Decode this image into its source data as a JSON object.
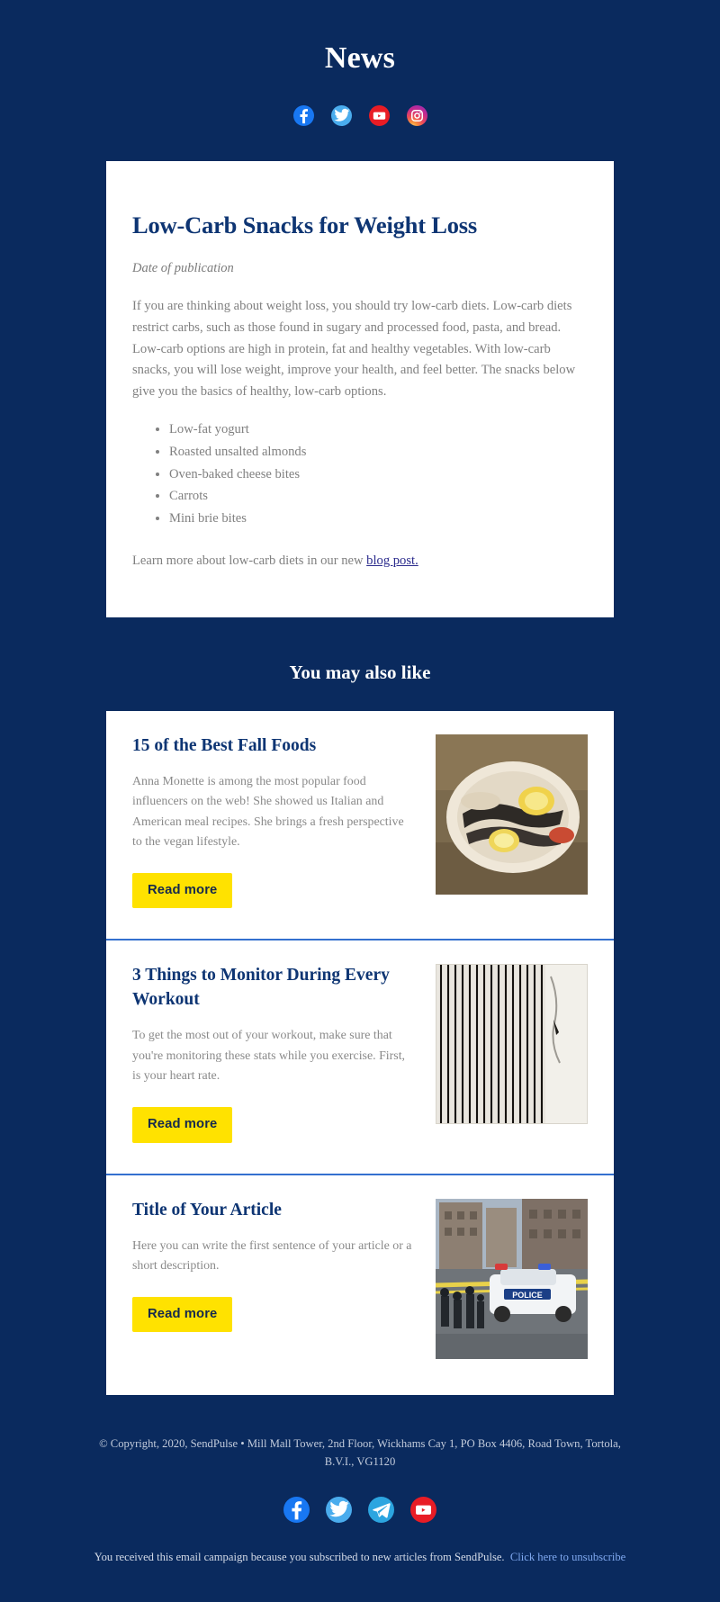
{
  "theme": {
    "background": "#0a2a5e",
    "card_background": "#ffffff",
    "heading_color": "#0e3573",
    "body_text_color": "#808080",
    "button_background": "#ffe200",
    "button_text_color": "#15294d",
    "divider_color": "#3470cf",
    "link_color": "#2a2a8c"
  },
  "header": {
    "title": "News",
    "social": [
      {
        "name": "facebook",
        "icon": "facebook-icon",
        "color": "#1877f2"
      },
      {
        "name": "twitter",
        "icon": "twitter-icon",
        "color": "#4aaced"
      },
      {
        "name": "youtube",
        "icon": "youtube-icon",
        "color": "#e81c25"
      },
      {
        "name": "instagram",
        "icon": "instagram-icon",
        "color": "#c3298f"
      }
    ]
  },
  "article": {
    "title": "Low-Carb Snacks for Weight Loss",
    "date": "Date of publication",
    "body": "If you are thinking about weight loss, you should try low-carb diets. Low-carb diets restrict carbs, such as those found in sugary and processed food, pasta, and bread. Low-carb options are high in protein, fat and healthy vegetables. With low-carb snacks, you will lose weight, improve your health, and feel better. The snacks below give you the basics of healthy, low-carb options.",
    "list": [
      "Low-fat yogurt",
      "Roasted unsalted almonds",
      "Oven-baked cheese bites",
      "Carrots",
      "Mini brie bites"
    ],
    "outro_prefix": "Learn more about low-carb diets in our new ",
    "outro_link": "blog post."
  },
  "section": {
    "heading": "You may also like"
  },
  "related": [
    {
      "title": "15 of the Best Fall Foods",
      "description": "Anna Monette is among the most popular food influencers on the web! She showed us Italian and American meal recipes. She brings a fresh perspective to the vegan lifestyle.",
      "button_label": "Read more",
      "image_alt": "plate-of-fish-with-lemon"
    },
    {
      "title": "3 Things to Monitor During Every Workout",
      "description": "To get the most out of your workout, make sure that you're monitoring these stats while you exercise. First, is your heart rate.",
      "button_label": "Read more",
      "image_alt": "ecg-heart-rate-printout"
    },
    {
      "title": "Title of Your Article",
      "description": "Here you can write the first sentence of your article or a short description.",
      "button_label": "Read more",
      "image_alt": "police-car-at-crime-scene"
    }
  ],
  "footer": {
    "copyright": "© Copyright, 2020, SendPulse • Mill Mall Tower, 2nd Floor, Wickhams Cay 1, PO Box 4406, Road Town, Tortola, B.V.I., VG1120",
    "social": [
      {
        "name": "facebook",
        "icon": "facebook-icon",
        "color": "#1877f2"
      },
      {
        "name": "twitter",
        "icon": "twitter-icon",
        "color": "#4aaced"
      },
      {
        "name": "telegram",
        "icon": "telegram-icon",
        "color": "#2ca5e0"
      },
      {
        "name": "youtube",
        "icon": "youtube-icon",
        "color": "#e81c25"
      }
    ],
    "note_text": "You received this email campaign because you subscribed to new articles from SendPulse.",
    "note_link": "Click here to unsubscribe"
  }
}
